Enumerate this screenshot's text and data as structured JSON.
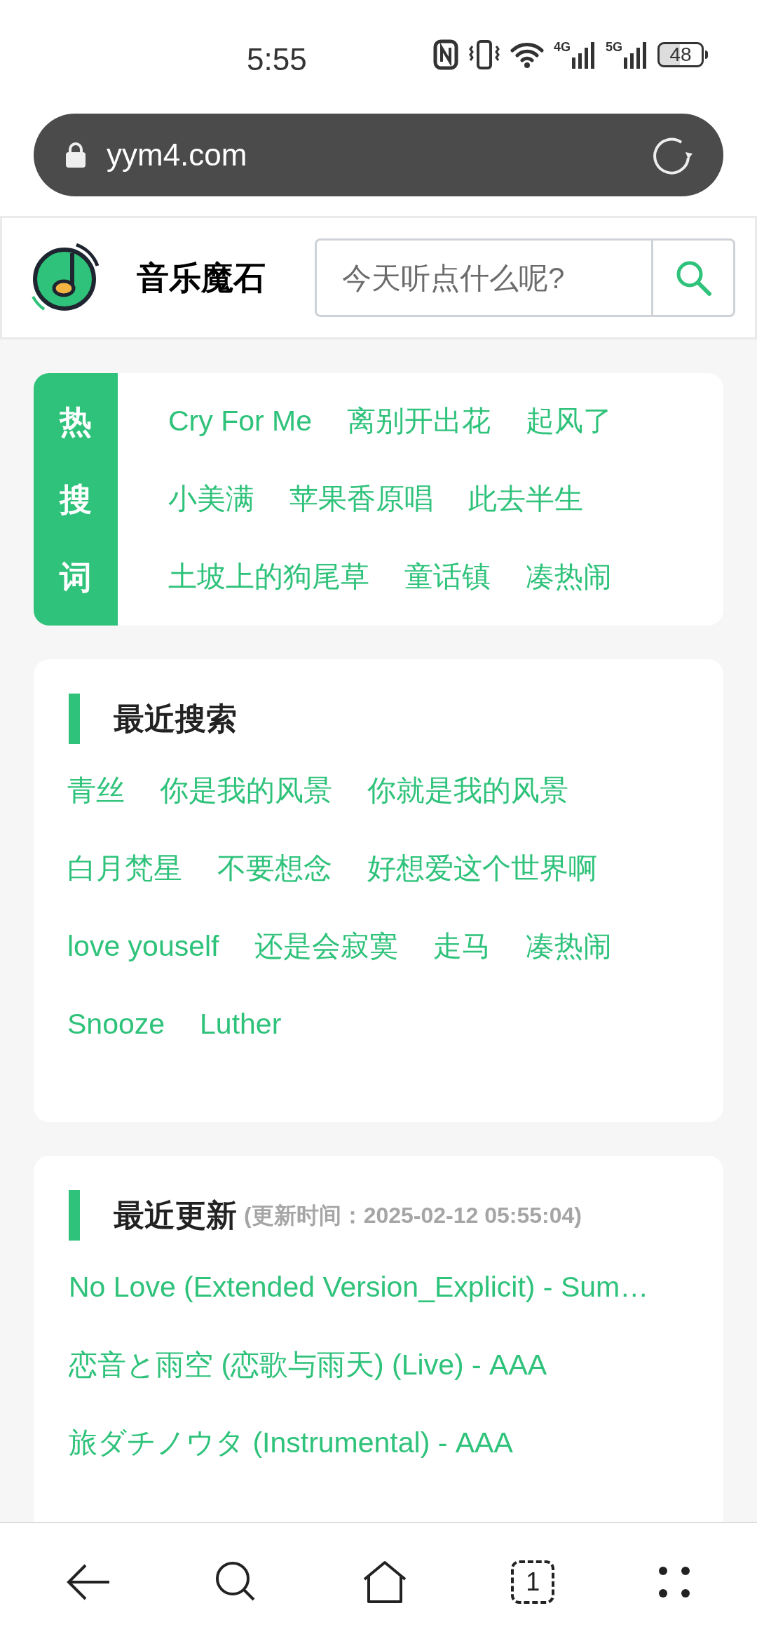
{
  "status_bar": {
    "time": "5:55",
    "network_1": "4G",
    "network_2": "5G",
    "battery": "48"
  },
  "address_bar": {
    "url": "yym4.com"
  },
  "header": {
    "site_name": "音乐魔石",
    "search": {
      "placeholder": "今天听点什么呢?"
    }
  },
  "hot_search": {
    "label": "热搜词",
    "rows": [
      [
        "Cry For Me",
        "离别开出花",
        "起风了"
      ],
      [
        "小美满",
        "苹果香原唱",
        "此去半生"
      ],
      [
        "土坡上的狗尾草",
        "童话镇",
        "凑热闹"
      ]
    ]
  },
  "recent_search": {
    "title": "最近搜索",
    "rows": [
      [
        "青丝",
        "你是我的风景",
        "你就是我的风景"
      ],
      [
        "白月梵星",
        "不要想念",
        "好想爱这个世界啊"
      ],
      [
        "love youself",
        "还是会寂寞",
        "走马",
        "凑热闹"
      ],
      [
        "Snooze",
        "Luther"
      ]
    ]
  },
  "recent_updates": {
    "title": "最近更新",
    "update_time": "(更新时间：2025-02-12 05:55:04)",
    "items": [
      "No Love (Extended Version_Explicit) - Sum…",
      "恋音と雨空 (恋歌与雨天) (Live) - AAA",
      "旅ダチノウタ (Instrumental) - AAA"
    ]
  },
  "nav_bar": {
    "tab_count": "1"
  }
}
